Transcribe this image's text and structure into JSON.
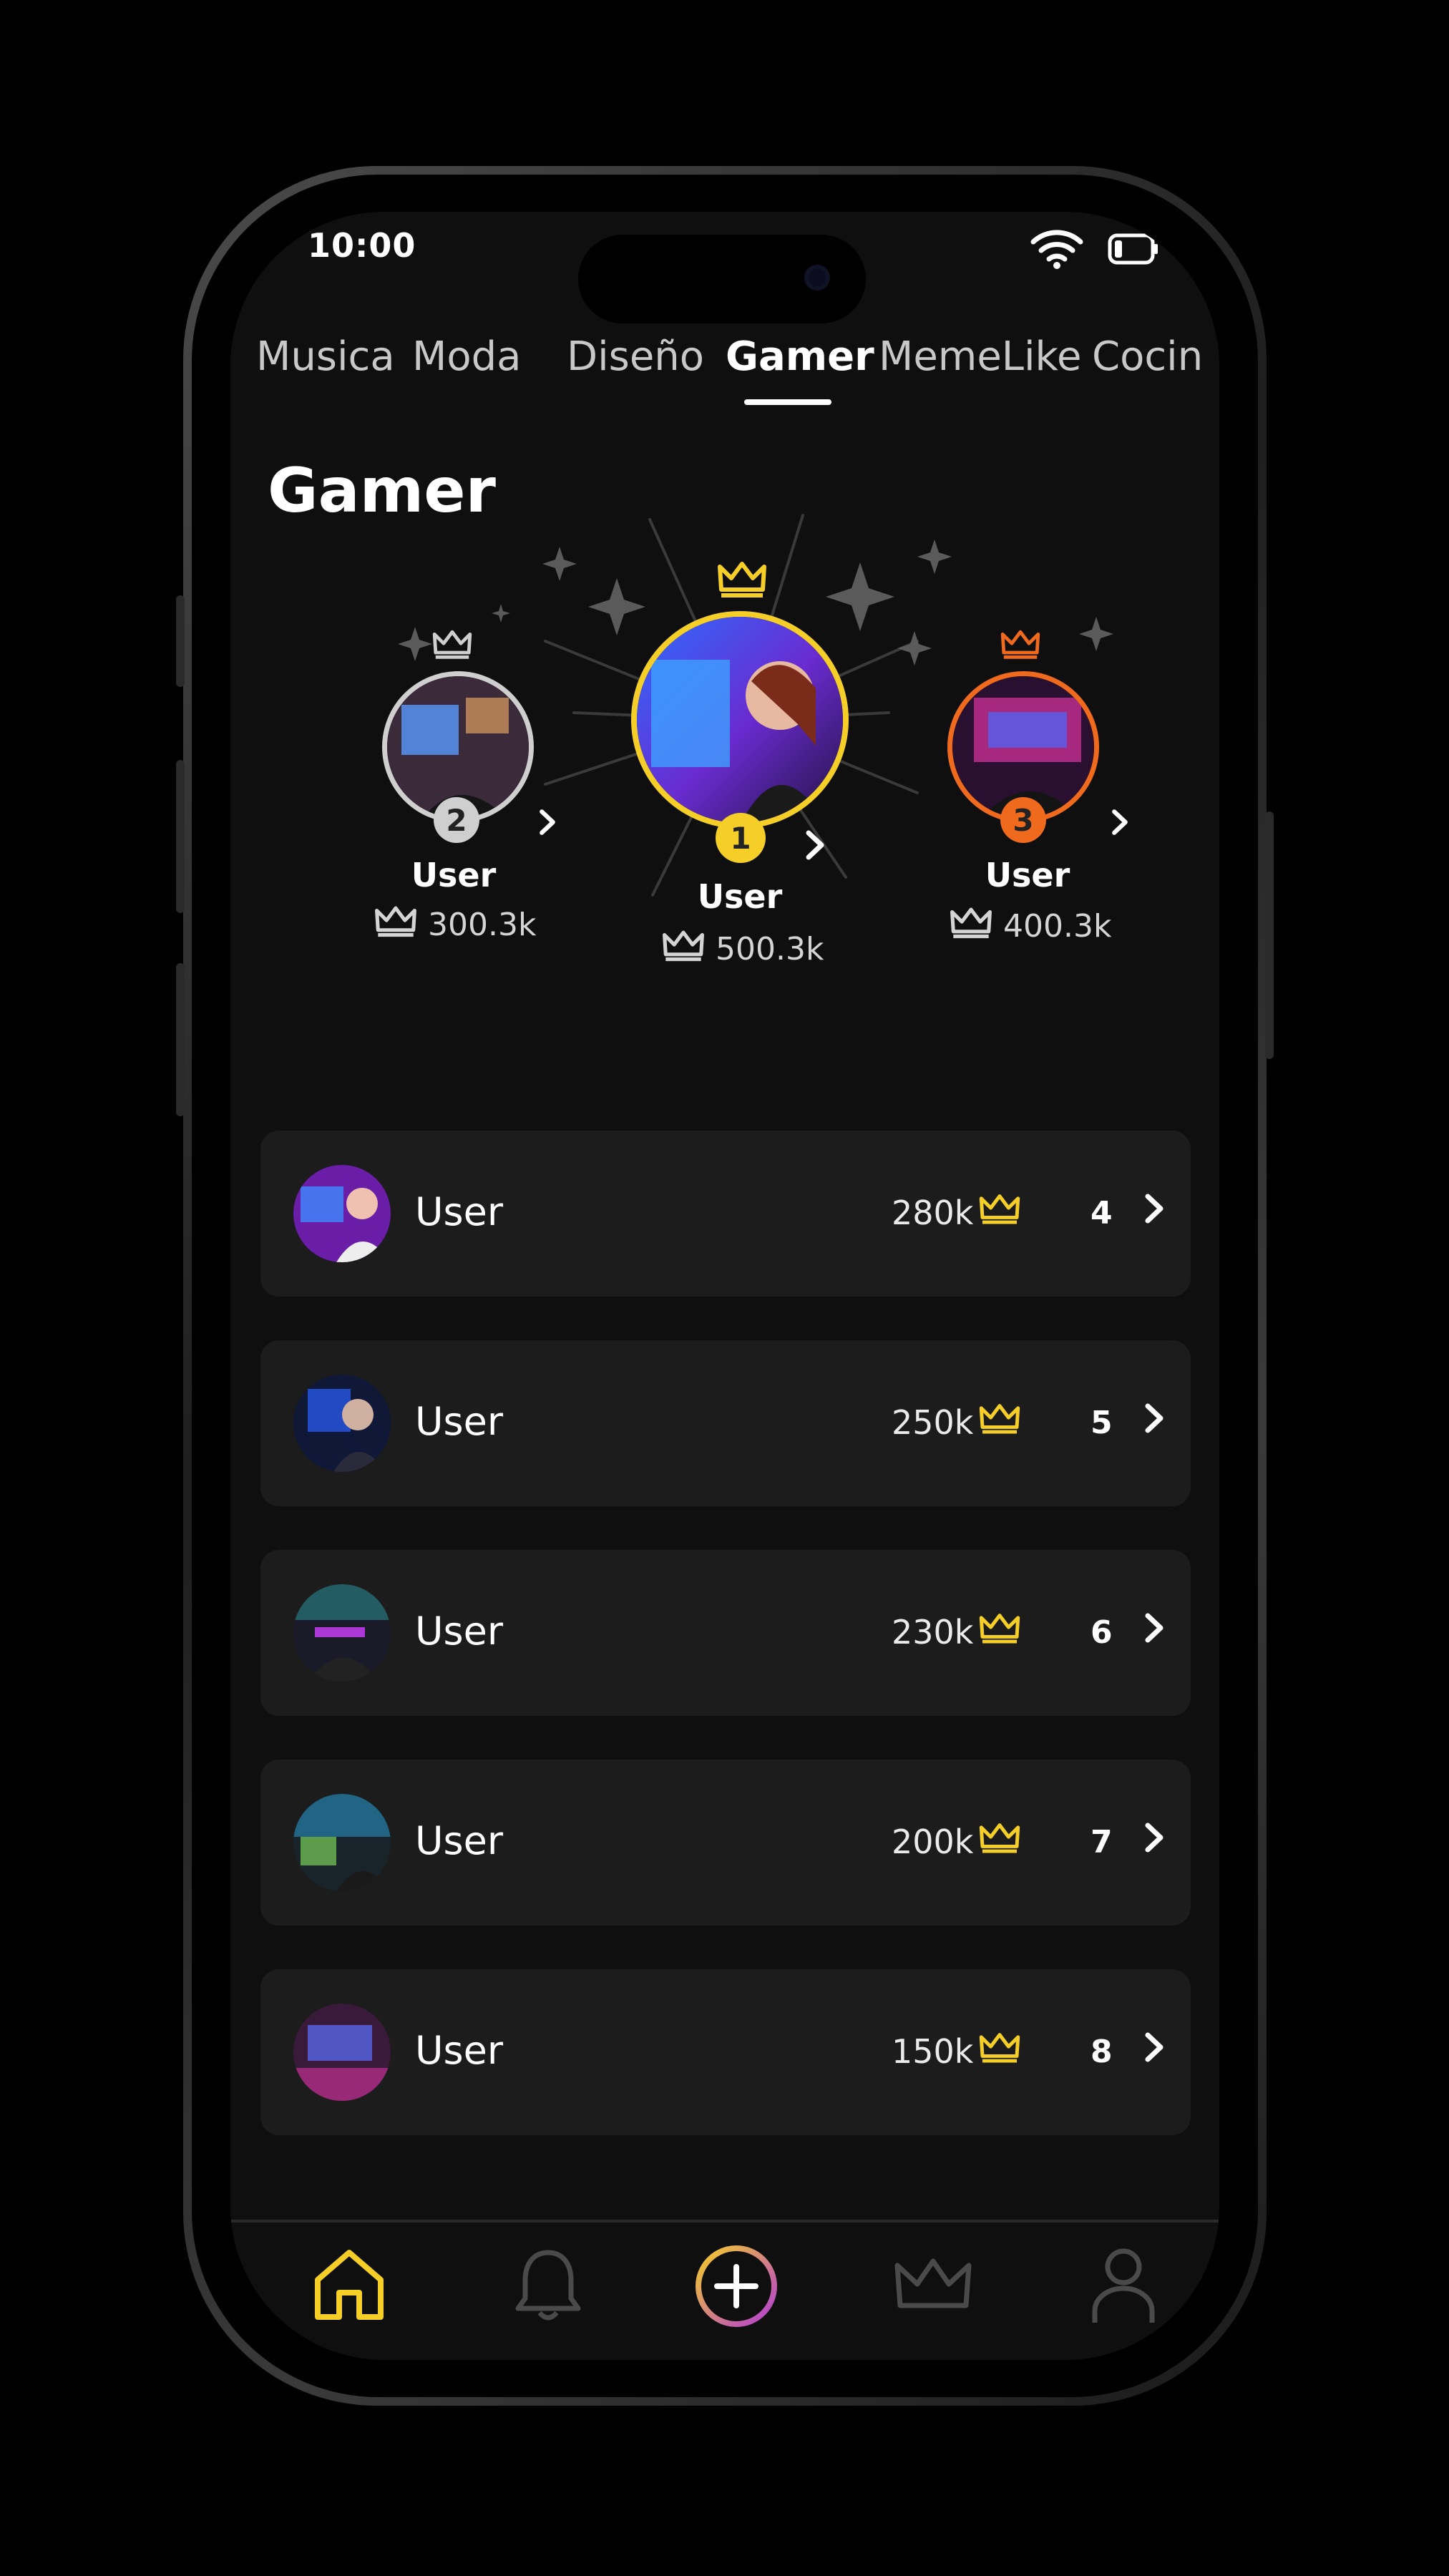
{
  "status_bar": {
    "time": "10:00"
  },
  "tabs": [
    {
      "label": "Musica"
    },
    {
      "label": "Moda"
    },
    {
      "label": "Diseño"
    },
    {
      "label": "Gamer"
    },
    {
      "label": "MemeLike"
    },
    {
      "label": "Cocin"
    }
  ],
  "active_tab": "Gamer",
  "page_title": "Gamer",
  "podium": {
    "first": {
      "rank": "1",
      "name": "User",
      "score": "500.3k"
    },
    "second": {
      "rank": "2",
      "name": "User",
      "score": "300.3k"
    },
    "third": {
      "rank": "3",
      "name": "User",
      "score": "400.3k"
    }
  },
  "leaderboard": [
    {
      "name": "User",
      "score": "280k",
      "rank": "4"
    },
    {
      "name": "User",
      "score": "250k",
      "rank": "5"
    },
    {
      "name": "User",
      "score": "230k",
      "rank": "6"
    },
    {
      "name": "User",
      "score": "200k",
      "rank": "7"
    },
    {
      "name": "User",
      "score": "150k",
      "rank": "8"
    }
  ],
  "nav": [
    {
      "icon": "home-icon",
      "active": true
    },
    {
      "icon": "bell-icon",
      "active": false
    },
    {
      "icon": "plus-circle-icon",
      "active": false
    },
    {
      "icon": "crown-icon",
      "active": false
    },
    {
      "icon": "profile-icon",
      "active": false
    }
  ],
  "colors": {
    "gold": "#f5cf27",
    "silver": "#cfcfcf",
    "bronze": "#f06a1d",
    "gradient_start": "#f5cf27",
    "gradient_end": "#b23bd6"
  }
}
